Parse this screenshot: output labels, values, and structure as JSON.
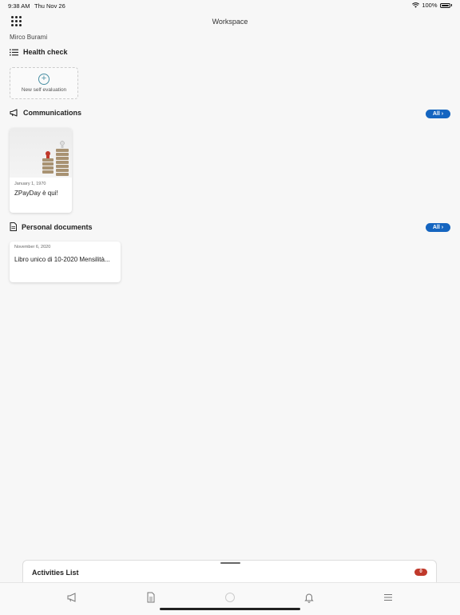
{
  "status": {
    "time": "9:38 AM",
    "date": "Thu Nov 26",
    "battery": "100%"
  },
  "header": {
    "title": "Workspace",
    "user": "Mirco Burami"
  },
  "health": {
    "title": "Health check",
    "new_eval_label": "New self evaluation"
  },
  "communications": {
    "title": "Communications",
    "all_label": "All",
    "items": [
      {
        "date": "January 1, 1970",
        "title": "ZPayDay è qui!"
      }
    ]
  },
  "documents": {
    "title": "Personal documents",
    "all_label": "All",
    "items": [
      {
        "date": "November 6, 2020",
        "title": "Libro unico di 10-2020 Mensilità..."
      }
    ]
  },
  "activities": {
    "title": "Activities List",
    "count": "0"
  },
  "colors": {
    "accent": "#1565c0",
    "badge": "#c0392b",
    "plus": "#4a90a4"
  },
  "tabs": [
    "megaphone-icon",
    "document-icon",
    "circle-icon",
    "bell-icon",
    "menu-icon"
  ]
}
